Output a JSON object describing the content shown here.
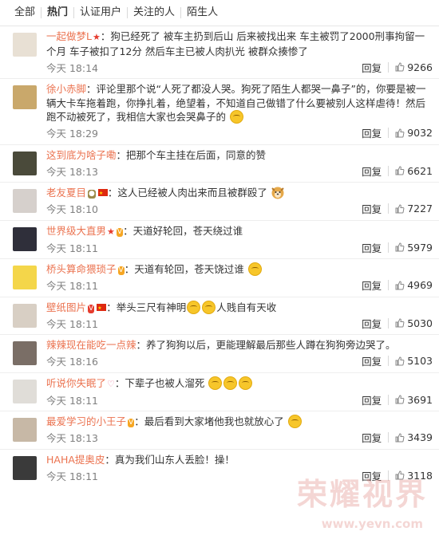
{
  "tabs": [
    "全部",
    "热门",
    "认证用户",
    "关注的人",
    "陌生人"
  ],
  "comments": [
    {
      "user": "一起做梦L",
      "text": "：狗已经死了 被车主扔到后山 后来被找出来 车主被罚了2000刑事拘留一个月 车子被扣了12分  然后车主已被人肉扒光 被群众揍惨了",
      "time": "今天 18:14",
      "reply": "回复",
      "likes": "9266",
      "avatar_color": "#e8e0d4"
    },
    {
      "user": "徐小赤脚",
      "text": "：评论里那个说“人死了都没人哭。狗死了陌生人都哭一鼻子”的，你要是被一辆大卡车拖着跑，你挣扎着，绝望着，不知道自己做错了什么要被别人这样虐待！然后跑不动被死了，我相信大家也会哭鼻子的",
      "time": "今天 18:29",
      "reply": "回复",
      "likes": "9032",
      "avatar_color": "#c9a86b"
    },
    {
      "user": "这到底为啥子嘞",
      "text": "：把那个车主挂在后面，同意的赞",
      "time": "今天 18:13",
      "reply": "回复",
      "likes": "6621",
      "avatar_color": "#4a4a3a"
    },
    {
      "user": "老友夏目",
      "text": "：这人已经被人肉出来而且被群殴了",
      "time": "今天 18:10",
      "reply": "回复",
      "likes": "7227",
      "avatar_color": "#d6d0cc"
    },
    {
      "user": "世界级大直男",
      "text": "：天道好轮回，苍天绕过谁",
      "time": "今天 18:11",
      "reply": "回复",
      "likes": "5979",
      "avatar_color": "#2f2f3a"
    },
    {
      "user": "桥头算命猥琐子",
      "text": "：天道有轮回，苍天饶过谁",
      "time": "今天 18:11",
      "reply": "回复",
      "likes": "4969",
      "avatar_color": "#f4d64a"
    },
    {
      "user": "壁纸图片",
      "text": "：举头三尺有神明",
      "text2": "人贱自有天收",
      "time": "今天 18:11",
      "reply": "回复",
      "likes": "5030",
      "avatar_color": "#d8cfc4"
    },
    {
      "user": "辣辣现在能吃一点辣",
      "text": "：养了狗狗以后，更能理解最后那些人蹲在狗狗旁边哭了。",
      "time": "今天 18:16",
      "reply": "回复",
      "likes": "5103",
      "avatar_color": "#7a6e66"
    },
    {
      "user": "听说你失眠了",
      "text": "：下辈子也被人溜死",
      "time": "今天 18:11",
      "reply": "回复",
      "likes": "3691",
      "avatar_color": "#e0ddd8"
    },
    {
      "user": "最爱学习的小王子",
      "text": "：最后看到大家堵他我也就放心了",
      "time": "今天 18:13",
      "reply": "回复",
      "likes": "3439",
      "avatar_color": "#c7b8a6"
    },
    {
      "user": "HAHA提奥皮",
      "text": "：真为我们山东人丢脸！操！",
      "time": "今天 18:11",
      "reply": "回复",
      "likes": "3118",
      "avatar_color": "#3a3a3a"
    }
  ],
  "watermark": {
    "text": "荣耀视界",
    "url": "www.yevn.com"
  },
  "colors": {
    "username": "#eb7350",
    "vip_orange": "#f6a623",
    "vip_red": "#e53b2e"
  }
}
